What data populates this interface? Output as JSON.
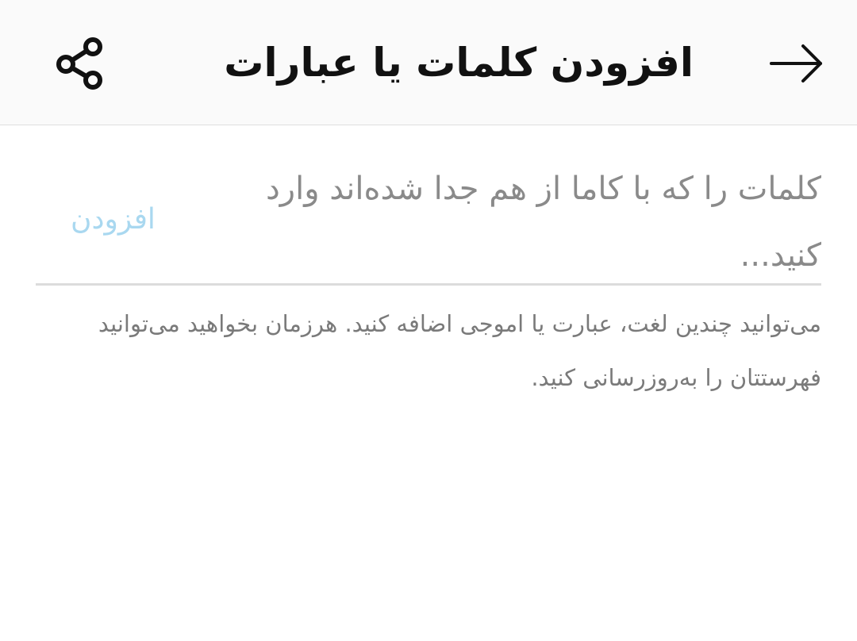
{
  "header": {
    "title": "افزودن کلمات یا عبارات",
    "back_icon": "arrow-right-icon",
    "share_icon": "share-icon"
  },
  "input": {
    "value": "",
    "placeholder": "کلمات را که با کاما از هم جدا شده‌اند وارد کنید...",
    "add_label": "افزودن"
  },
  "help": {
    "text": "می‌توانید چندین لغت، عبارت یا اموجی اضافه کنید. هرزمان بخواهید می‌توانید فهرستتان را به‌روزرسانی کنید."
  },
  "colors": {
    "add_disabled": "#a9d8f0",
    "divider": "#dcdcdc",
    "header_bg": "#fafafa"
  }
}
